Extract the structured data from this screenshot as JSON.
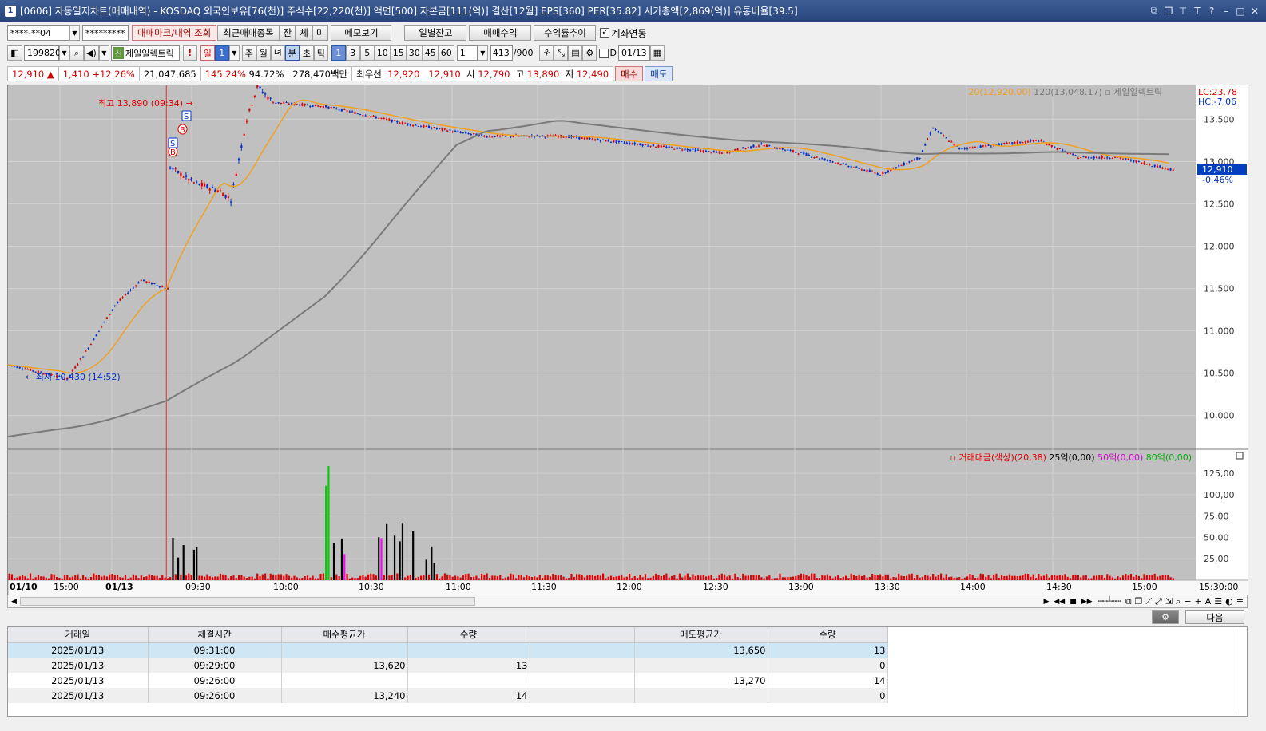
{
  "window": {
    "title": "[0606] 자동일지차트(매매내역) - KOSDAQ 외국인보유[76(천)] 주식수[22,220(천)] 액면[500] 자본금[111(억)] 결산[12월] EPS[360] PER[35.82] 시가총액[2,869(억)] 유통비율[39.5]",
    "app_no": "1"
  },
  "toolbar1": {
    "account": "****-**04",
    "password": "*********",
    "tab_marks": "매매마크/내역 조회",
    "tab_recent": "최근매매종목",
    "b_jan": "잔",
    "b_che": "체",
    "b_mi": "미",
    "memo": "메모보기",
    "daily": "일별잔고",
    "profit": "매매수익",
    "rate": "수익률추이",
    "link_label": "계좌연동",
    "link_checked": true
  },
  "toolbar2": {
    "code": "199820",
    "sin": "신",
    "name": "제일일렉트릭",
    "excl": "!",
    "period_day": "일",
    "period_num": "1",
    "week": "주",
    "month": "월",
    "year": "년",
    "minute": "분",
    "second": "초",
    "tick": "틱",
    "intervals": [
      "1",
      "3",
      "5",
      "10",
      "15",
      "30",
      "45",
      "60"
    ],
    "count": "1",
    "bars": "413",
    "bars_total": "/900",
    "d_label": "D",
    "date": "01/13"
  },
  "quote": {
    "price": "12,910",
    "arrow": "▲",
    "change": "1,410",
    "pct": "+12.26%",
    "volume": "21,047,685",
    "vol_ratio": "145.24%",
    "ratio2": "94.72%",
    "amount": "278,470백만",
    "best_label": "최우선",
    "best_ask": "12,920",
    "best_bid": "12,910",
    "open_label": "시",
    "open": "12,790",
    "high_label": "고",
    "high": "13,890",
    "low_label": "저",
    "low": "12,490",
    "buy": "매수",
    "sell": "매도"
  },
  "chart_data": [
    {
      "type": "line",
      "title": "제일일렉트릭",
      "series": [
        {
          "name": "20(12,920.00)",
          "color": "#f0a020"
        },
        {
          "name": "120(13,048.17)",
          "color": "#7a7a7a"
        }
      ],
      "price_labels": {
        "lc": "LC:23.78",
        "hc": "HC:-7.06",
        "current": "12,910",
        "current_pct": "-0.46%"
      },
      "annotations": {
        "high": "최고 13,890 (09:34)",
        "low": "최저 10,430 (14:52)"
      },
      "yticks": [
        10000,
        10500,
        11000,
        11500,
        12000,
        12500,
        13000,
        13500
      ],
      "ylim": [
        9600,
        13900
      ],
      "price_points": [
        {
          "x": "01/10 14:30",
          "y": 10600
        },
        {
          "x": "01/10 14:52",
          "y": 10430
        },
        {
          "x": "01/10 15:00",
          "y": 10800
        },
        {
          "x": "01/10 15:10",
          "y": 11300
        },
        {
          "x": "01/10 15:20",
          "y": 11600
        },
        {
          "x": "01/10 15:30",
          "y": 11500
        },
        {
          "x": "09:00",
          "y": 12950
        },
        {
          "x": "09:10",
          "y": 12750
        },
        {
          "x": "09:20",
          "y": 12650
        },
        {
          "x": "09:24",
          "y": 12550
        },
        {
          "x": "09:30",
          "y": 13500
        },
        {
          "x": "09:34",
          "y": 13890
        },
        {
          "x": "09:40",
          "y": 13700
        },
        {
          "x": "10:00",
          "y": 13650
        },
        {
          "x": "10:30",
          "y": 13450
        },
        {
          "x": "11:00",
          "y": 13300
        },
        {
          "x": "11:30",
          "y": 13300
        },
        {
          "x": "12:00",
          "y": 13200
        },
        {
          "x": "12:30",
          "y": 13100
        },
        {
          "x": "12:45",
          "y": 13200
        },
        {
          "x": "13:00",
          "y": 13100
        },
        {
          "x": "13:30",
          "y": 12850
        },
        {
          "x": "13:45",
          "y": 13050
        },
        {
          "x": "13:50",
          "y": 13400
        },
        {
          "x": "14:00",
          "y": 13150
        },
        {
          "x": "14:30",
          "y": 13250
        },
        {
          "x": "14:45",
          "y": 13050
        },
        {
          "x": "15:00",
          "y": 13050
        },
        {
          "x": "15:20",
          "y": 12910
        }
      ]
    },
    {
      "type": "bar",
      "title": "거래대금(색상)(20,38)",
      "legend": [
        "25억(0,00)",
        "50억(0,00)",
        "80억(0,00)"
      ],
      "yticks": [
        "25,00",
        "50,00",
        "75,00",
        "100,00",
        "125,00"
      ],
      "ylim": [
        0,
        140
      ]
    }
  ],
  "xaxis": {
    "labels": [
      "01/10",
      "15:00",
      "01/13",
      "09:30",
      "10:00",
      "10:30",
      "11:00",
      "11:30",
      "12:00",
      "12:30",
      "13:00",
      "13:30",
      "14:00",
      "14:30",
      "15:00",
      "15:30:00"
    ]
  },
  "trades_panel": {
    "next": "다음",
    "columns": [
      "거래일",
      "체결시간",
      "매수평균가",
      "수량",
      "",
      "매도평균가",
      "수량"
    ],
    "rows": [
      [
        "2025/01/13",
        "09:31:00",
        "",
        "",
        "",
        "13,650",
        "13"
      ],
      [
        "2025/01/13",
        "09:29:00",
        "13,620",
        "13",
        "",
        "",
        "0"
      ],
      [
        "2025/01/13",
        "09:26:00",
        "",
        "",
        "",
        "13,270",
        "14"
      ],
      [
        "2025/01/13",
        "09:26:00",
        "13,240",
        "14",
        "",
        "",
        "0"
      ]
    ]
  }
}
